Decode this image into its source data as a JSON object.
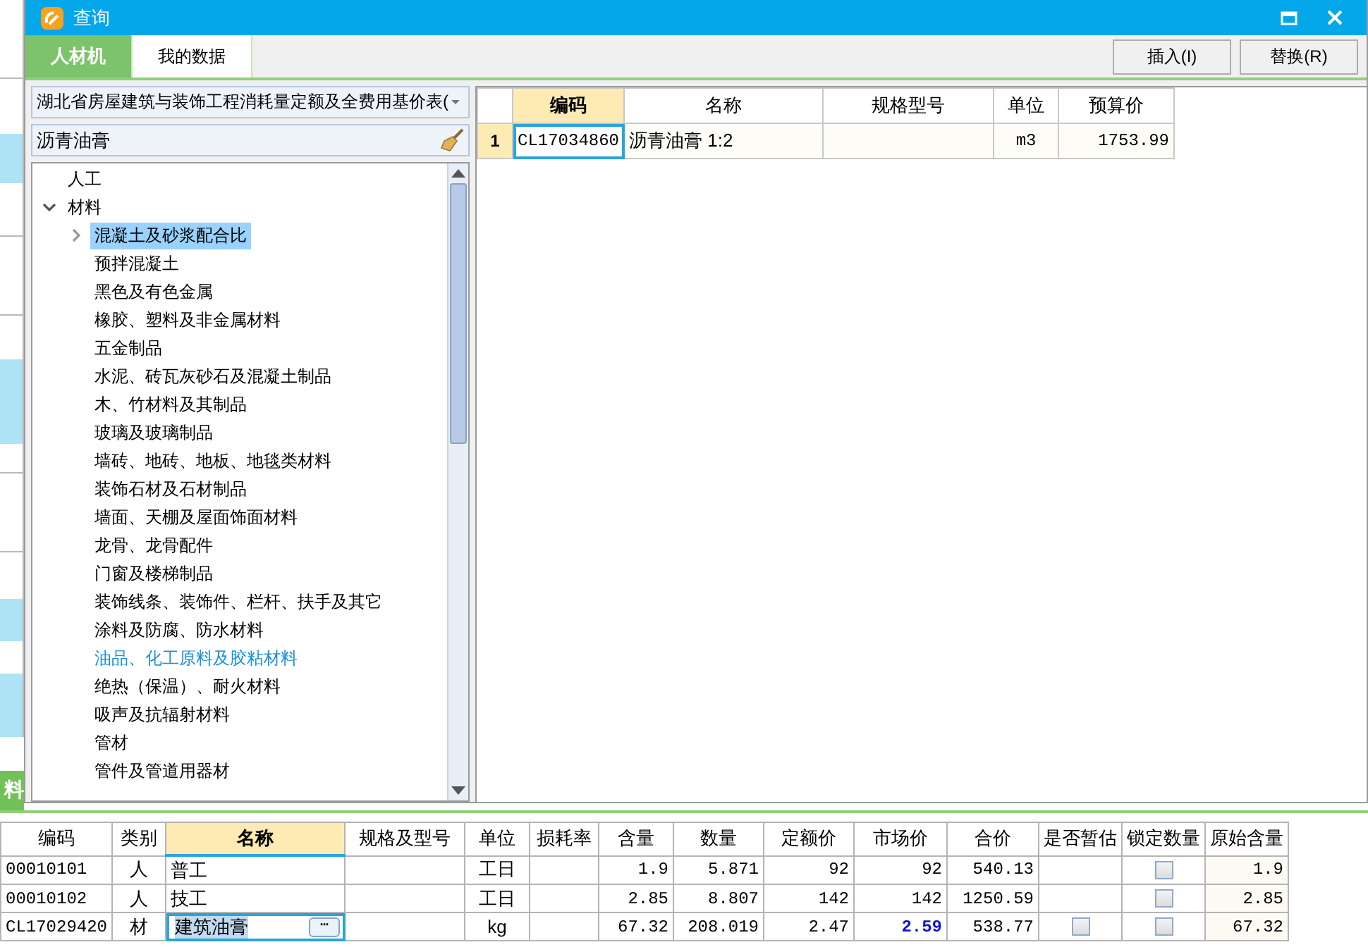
{
  "background": {
    "tab": "料"
  },
  "window": {
    "title": "查询"
  },
  "tabs": [
    {
      "label": "人材机",
      "selected": true
    },
    {
      "label": "我的数据",
      "selected": false
    }
  ],
  "buttons": [
    "插入(I)",
    "替换(R)"
  ],
  "library": {
    "value": "湖北省房屋建筑与装饰工程消耗量定额及全费用基价表("
  },
  "search": {
    "value": "沥青油膏"
  },
  "tree": [
    {
      "label": "人工",
      "kind": "leaf",
      "selected": false,
      "hovered": false
    },
    {
      "label": "材料",
      "kind": "branch",
      "expanded": true,
      "selected": false,
      "hovered": false,
      "children": [
        {
          "label": "混凝土及砂浆配合比",
          "kind": "branch",
          "expanded": false,
          "selected": true,
          "hovered": false
        },
        {
          "label": "预拌混凝土",
          "kind": "leaf",
          "selected": false,
          "hovered": false
        },
        {
          "label": "黑色及有色金属",
          "kind": "leaf",
          "selected": false,
          "hovered": false
        },
        {
          "label": "橡胶、塑料及非金属材料",
          "kind": "leaf",
          "selected": false,
          "hovered": false
        },
        {
          "label": "五金制品",
          "kind": "leaf",
          "selected": false,
          "hovered": false
        },
        {
          "label": "水泥、砖瓦灰砂石及混凝土制品",
          "kind": "leaf",
          "selected": false,
          "hovered": false
        },
        {
          "label": "木、竹材料及其制品",
          "kind": "leaf",
          "selected": false,
          "hovered": false
        },
        {
          "label": "玻璃及玻璃制品",
          "kind": "leaf",
          "selected": false,
          "hovered": false
        },
        {
          "label": "墙砖、地砖、地板、地毯类材料",
          "kind": "leaf",
          "selected": false,
          "hovered": false
        },
        {
          "label": "装饰石材及石材制品",
          "kind": "leaf",
          "selected": false,
          "hovered": false
        },
        {
          "label": "墙面、天棚及屋面饰面材料",
          "kind": "leaf",
          "selected": false,
          "hovered": false
        },
        {
          "label": "龙骨、龙骨配件",
          "kind": "leaf",
          "selected": false,
          "hovered": false
        },
        {
          "label": "门窗及楼梯制品",
          "kind": "leaf",
          "selected": false,
          "hovered": false
        },
        {
          "label": "装饰线条、装饰件、栏杆、扶手及其它",
          "kind": "leaf",
          "selected": false,
          "hovered": false
        },
        {
          "label": "涂料及防腐、防水材料",
          "kind": "leaf",
          "selected": false,
          "hovered": false
        },
        {
          "label": "油品、化工原料及胶粘材料",
          "kind": "leaf",
          "selected": false,
          "hovered": true
        },
        {
          "label": "绝热（保温）、耐火材料",
          "kind": "leaf",
          "selected": false,
          "hovered": false
        },
        {
          "label": "吸声及抗辐射材料",
          "kind": "leaf",
          "selected": false,
          "hovered": false
        },
        {
          "label": "管材",
          "kind": "leaf",
          "selected": false,
          "hovered": false
        },
        {
          "label": "管件及管道用器材",
          "kind": "leaf",
          "selected": false,
          "hovered": false
        }
      ]
    }
  ],
  "results": {
    "columns": [
      "编码",
      "名称",
      "规格型号",
      "单位",
      "预算价"
    ],
    "rows": [
      {
        "number": "1",
        "code": "CL17034860",
        "name": "沥青油膏 1:2",
        "unit": "m3",
        "price": "1753.99",
        "selected": true
      }
    ]
  },
  "materials": {
    "columns": [
      "编码",
      "类别",
      "名称",
      "规格及型号",
      "单位",
      "损耗率",
      "含量",
      "数量",
      "定额价",
      "市场价",
      "合价",
      "是否暂估",
      "锁定数量",
      "原始含量"
    ],
    "rows": [
      {
        "code": "00010101",
        "type": "人",
        "name": "普工",
        "unit": "工日",
        "content": "1.9",
        "quantity": "5.871",
        "quota_price": "92",
        "market_price": "92",
        "price_adjusted": false,
        "total": "540.13",
        "provisional": null,
        "locked": false,
        "original_content": "1.9",
        "editing": false
      },
      {
        "code": "00010102",
        "type": "人",
        "name": "技工",
        "unit": "工日",
        "content": "2.85",
        "quantity": "8.807",
        "quota_price": "142",
        "market_price": "142",
        "price_adjusted": false,
        "total": "1250.59",
        "provisional": null,
        "locked": false,
        "original_content": "2.85",
        "editing": false
      },
      {
        "code": "CL17029420",
        "type": "材",
        "name": "建筑油膏",
        "unit": "kg",
        "content": "67.32",
        "quantity": "208.019",
        "quota_price": "2.47",
        "market_price": "2.59",
        "price_adjusted": true,
        "total": "538.77",
        "provisional": false,
        "locked": false,
        "original_content": "67.32",
        "editing": true,
        "edit_button": "⋯"
      }
    ]
  }
}
